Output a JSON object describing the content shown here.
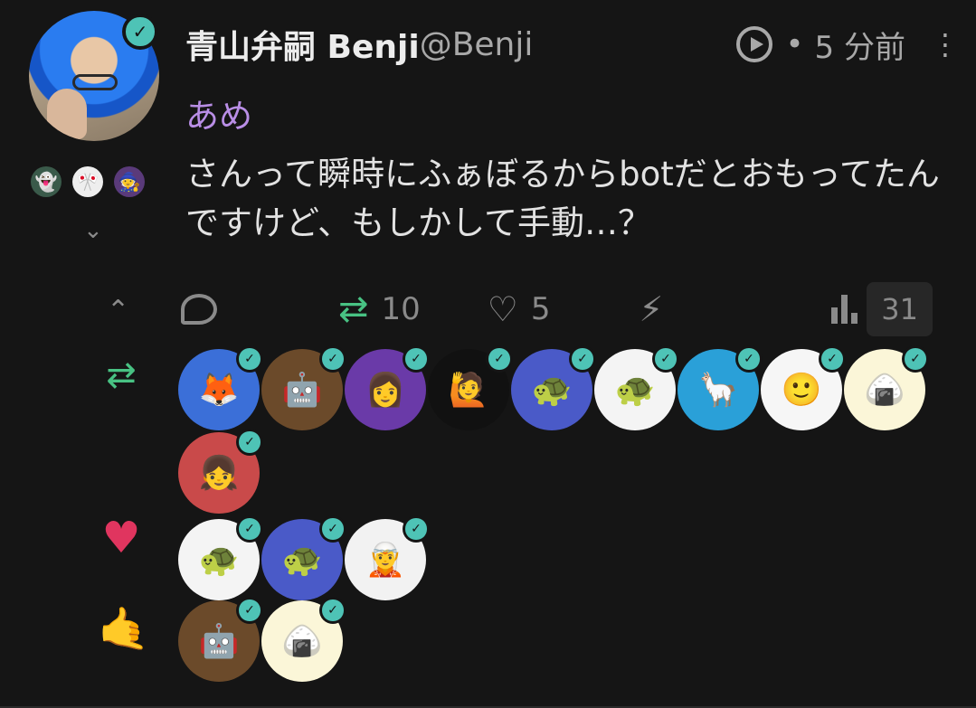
{
  "author": {
    "display_name": "青山弁嗣 Benji",
    "handle": "@Benji",
    "time": "5 分前",
    "dot": "•"
  },
  "post": {
    "content_warning": "あめ",
    "body": "さんって瞬時にふぁぼるからbotだとおもってたんですけど、もしかして手動…？"
  },
  "actions": {
    "boost_count": "10",
    "like_count": "5",
    "view_count": "31"
  },
  "icons": {
    "check": "✓",
    "chevron_down": "⌄",
    "chevron_up": "⌃",
    "boost": "⇄",
    "heart_outline": "♡",
    "bolt": "⚡",
    "heart": "♥",
    "hand": "🤙",
    "more": "⋮"
  },
  "boosters": [
    {
      "name": "fox",
      "bg": "#3b6fd8",
      "glyph": "🦊"
    },
    {
      "name": "robot",
      "bg": "#6b4a2a",
      "glyph": "🤖"
    },
    {
      "name": "purple-girl",
      "bg": "#6a3aa8",
      "glyph": "👩"
    },
    {
      "name": "phone-man",
      "bg": "#111111",
      "glyph": "🙋"
    },
    {
      "name": "turtle-helmet",
      "bg": "#4a5ac8",
      "glyph": "🐢"
    },
    {
      "name": "turtle",
      "bg": "#f4f4f4",
      "glyph": "🐢"
    },
    {
      "name": "alpaca",
      "bg": "#2aa0d8",
      "glyph": "🦙"
    },
    {
      "name": "fez-man",
      "bg": "#f6f6f6",
      "glyph": "🙂"
    },
    {
      "name": "onigiri",
      "bg": "#fbf6d8",
      "glyph": "🍙"
    },
    {
      "name": "anime-girl",
      "bg": "#c94a4a",
      "glyph": "👧"
    }
  ],
  "likers": [
    {
      "name": "turtle",
      "bg": "#f4f4f4",
      "glyph": "🐢"
    },
    {
      "name": "turtle-helmet",
      "bg": "#4a5ac8",
      "glyph": "🐢"
    },
    {
      "name": "white-hair",
      "bg": "#f2f2f2",
      "glyph": "🧝"
    }
  ],
  "hand_reactors": [
    {
      "name": "robot",
      "bg": "#6b4a2a",
      "glyph": "🤖"
    },
    {
      "name": "onigiri",
      "bg": "#fbf6d8",
      "glyph": "🍙"
    }
  ],
  "mini_emojis": [
    {
      "name": "ghost-emoji",
      "bg": "#3a5a4a",
      "glyph": "👻"
    },
    {
      "name": "flags-emoji",
      "bg": "#eeeeee",
      "glyph": "🎌"
    },
    {
      "name": "hood-emoji",
      "bg": "#5a3a7a",
      "glyph": "🧙"
    }
  ]
}
